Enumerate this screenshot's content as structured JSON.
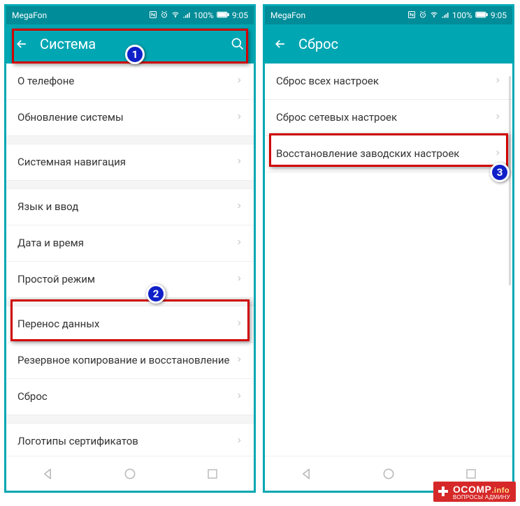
{
  "status": {
    "carrier": "MegaFon",
    "battery": "100%",
    "time": "9:05"
  },
  "left": {
    "title": "Система",
    "items": [
      "О телефоне",
      "Обновление системы",
      "Системная навигация",
      "Язык и ввод",
      "Дата и время",
      "Простой режим",
      "Перенос данных",
      "Резервное копирование и восстановление",
      "Сброс",
      "Логотипы сертификатов"
    ]
  },
  "right": {
    "title": "Сброс",
    "items": [
      "Сброс всех настроек",
      "Сброс сетевых настроек",
      "Восстановление заводских настроек"
    ]
  },
  "badges": {
    "b1": "1",
    "b2": "2",
    "b3": "3"
  },
  "watermark": {
    "brand": "OCOMP",
    "suffix": ".info",
    "sub": "ВОПРОСЫ АДМИНУ"
  }
}
